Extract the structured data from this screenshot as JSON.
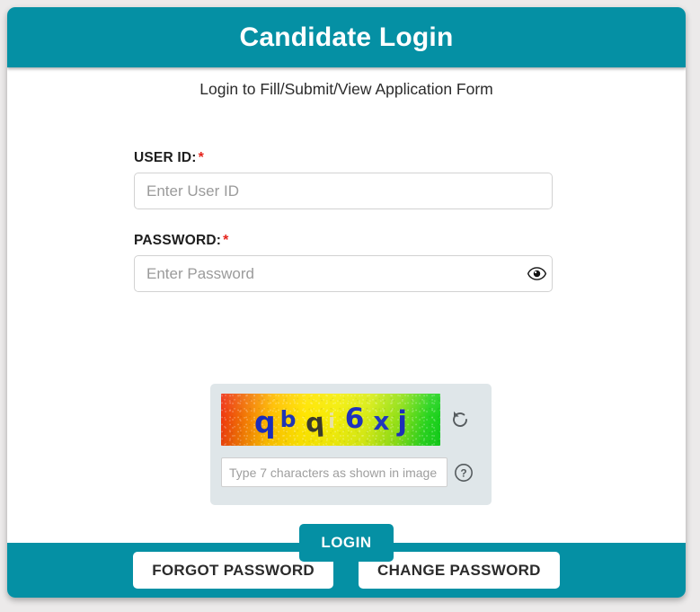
{
  "header": {
    "title": "Candidate Login"
  },
  "body": {
    "subtitle": "Login to Fill/Submit/View Application Form"
  },
  "form": {
    "user_id": {
      "label": "USER ID:",
      "required_mark": "*",
      "placeholder": "Enter User ID",
      "value": ""
    },
    "password": {
      "label": "PASSWORD:",
      "required_mark": "*",
      "placeholder": "Enter Password",
      "value": ""
    }
  },
  "captcha": {
    "text": "qbqi6xj",
    "characters": [
      "q",
      "b",
      "q",
      "i",
      "6",
      "x",
      "j"
    ],
    "input": {
      "placeholder": "Type 7 characters as shown in image",
      "value": ""
    },
    "refresh_icon": "refresh-icon",
    "help_icon": "help-icon"
  },
  "actions": {
    "login_label": "LOGIN",
    "forgot_password_label": "FORGOT PASSWORD",
    "change_password_label": "CHANGE PASSWORD"
  },
  "icons": {
    "password_visibility": "eye-icon"
  },
  "colors": {
    "brand_teal": "#0590a4",
    "required_red": "#e5231b",
    "captcha_panel": "#dfe6e9",
    "page_background": "#eceaea"
  }
}
